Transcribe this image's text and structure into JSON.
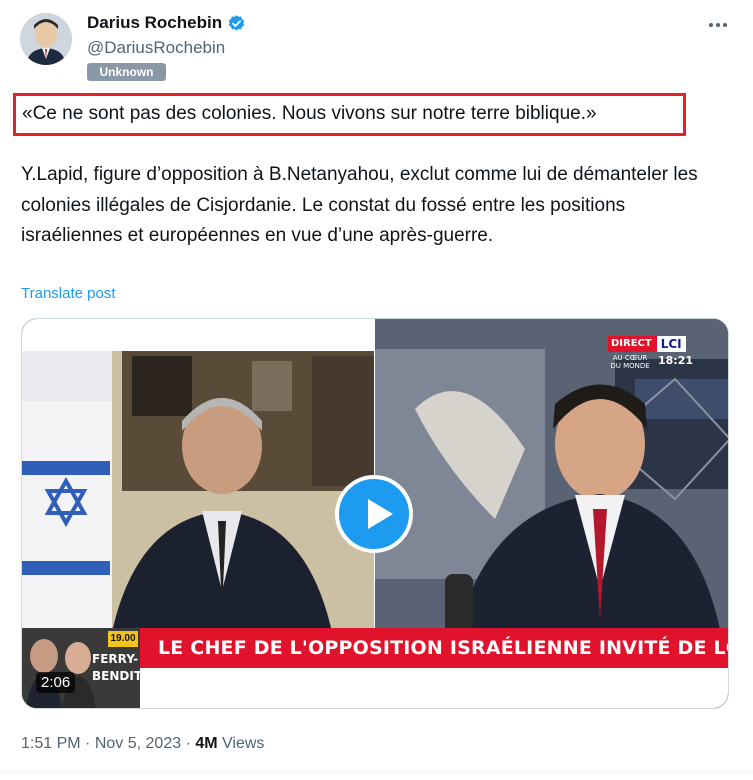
{
  "author": {
    "display_name": "Darius Rochebin",
    "handle": "@DariusRochebin",
    "label_badge": "Unknown",
    "verified_color": "#1d9bf0"
  },
  "post": {
    "quote": "«Ce ne sont pas des colonies. Nous vivons sur notre terre biblique.»",
    "body": "Y.Lapid, figure d’opposition à B.Netanyahou, exclut comme lui de démanteler les colonies illégales de Cisjordanie. Le constat du fossé entre les positions israéliennes et européennes en vue d’une après-guerre.",
    "translate_label": "Translate post"
  },
  "video": {
    "duration": "2:06",
    "ticker": "LE CHEF DE L'OPPOSITION ISRAÉLIENNE INVITÉ DE LCI",
    "channel_direct": "DIRECT",
    "channel_name": "LCI",
    "channel_tagline": "AU CŒUR DU MONDE",
    "clock": "18:21",
    "thumb_time": "19.00",
    "thumb_label": "FERRY-BENDIT"
  },
  "meta": {
    "time": "1:51 PM",
    "date": "Nov 5, 2023",
    "views_count": "4M",
    "views_label": "Views"
  },
  "colors": {
    "quote_border": "#e0222b",
    "link": "#1d9bf0",
    "badge": "#8b98a5",
    "ticker": "#e1132c"
  }
}
